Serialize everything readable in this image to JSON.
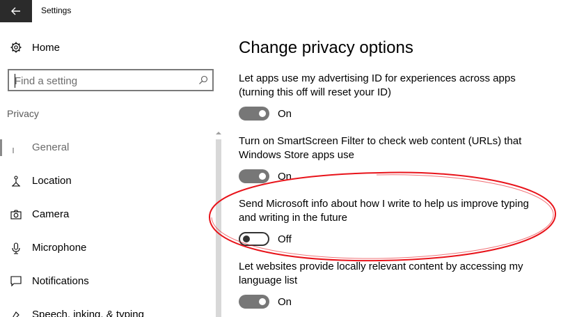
{
  "window": {
    "title": "Settings"
  },
  "sidebar": {
    "home_label": "Home",
    "search": {
      "placeholder": "Find a setting"
    },
    "section_label": "Privacy",
    "items": [
      {
        "label": "General",
        "selected": true
      },
      {
        "label": "Location"
      },
      {
        "label": "Camera"
      },
      {
        "label": "Microphone"
      },
      {
        "label": "Notifications"
      },
      {
        "label": "Speech, inking, & typing"
      }
    ]
  },
  "main": {
    "title": "Change privacy options",
    "settings": [
      {
        "description": "Let apps use my advertising ID for experiences across apps (turning this off will reset your ID)",
        "state": "On",
        "on": true
      },
      {
        "description": "Turn on SmartScreen Filter to check web content (URLs) that Windows Store apps use",
        "state": "On",
        "on": true
      },
      {
        "description": "Send Microsoft info about how I write to help us improve typing and writing in the future",
        "state": "Off",
        "on": false
      },
      {
        "description": "Let websites provide locally relevant content by accessing my language list",
        "state": "On",
        "on": true
      }
    ]
  },
  "colors": {
    "titlebar_back": "#2b2b2b",
    "toggle_on": "#777777",
    "annotation": "#e8131a"
  },
  "icons": {
    "back": "back-arrow-icon",
    "home": "gear-icon",
    "search": "search-icon",
    "general": "lock-icon",
    "location": "location-person-icon",
    "camera": "camera-icon",
    "microphone": "microphone-icon",
    "notifications": "notification-icon",
    "speech": "speech-icon"
  }
}
